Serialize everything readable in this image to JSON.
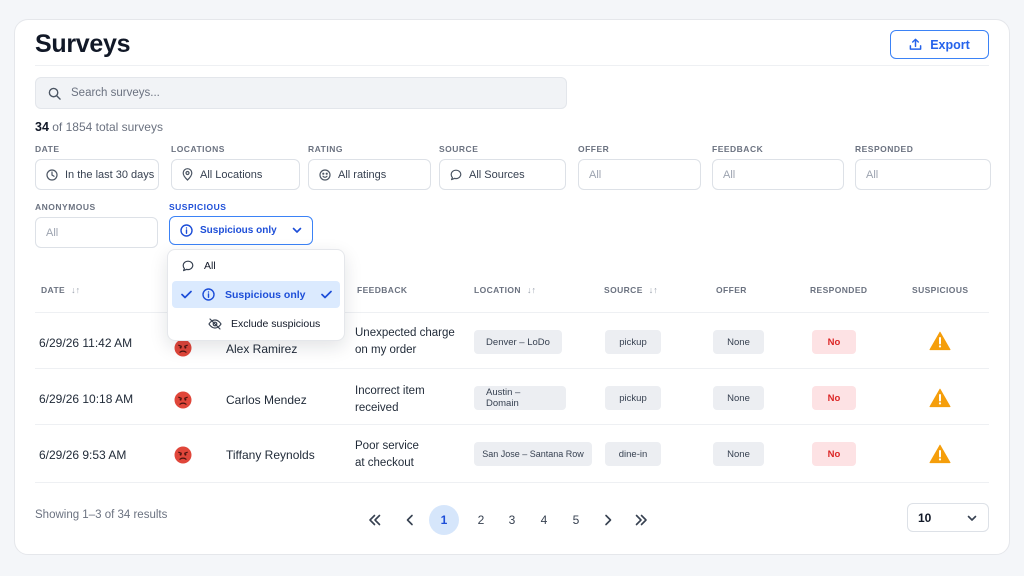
{
  "header": {
    "title": "Surveys",
    "export_label": "Export"
  },
  "search": {
    "placeholder": "Search surveys..."
  },
  "summary": {
    "shown": "34",
    "rest": "of 1854 total surveys"
  },
  "filters": {
    "date": {
      "label": "DATE",
      "value": "In the last 30 days"
    },
    "locations": {
      "label": "LOCATIONS",
      "value": "All Locations"
    },
    "rating": {
      "label": "RATING",
      "value": "All ratings"
    },
    "source": {
      "label": "SOURCE",
      "value": "All Sources"
    },
    "offer": {
      "label": "OFFER",
      "value": "All"
    },
    "feedback": {
      "label": "FEEDBACK",
      "value": "All"
    },
    "responded": {
      "label": "RESPONDED",
      "value": "All"
    },
    "anonymous": {
      "label": "ANONYMOUS",
      "value": "All"
    },
    "suspicious": {
      "label": "SUSPICIOUS",
      "value": "Suspicious only"
    }
  },
  "dropdown": {
    "options": [
      {
        "label": "All",
        "icon": "speech-bubble-icon"
      },
      {
        "label": "Suspicious only",
        "icon": "info-circle-icon",
        "selected": true
      },
      {
        "label": "Exclude suspicious",
        "icon": "eye-off-icon"
      }
    ]
  },
  "table": {
    "columns": [
      "DATE",
      "FEEDBACK",
      "LOCATION",
      "SOURCE",
      "OFFER",
      "RESPONDED",
      "SUSPICIOUS"
    ],
    "rows": [
      {
        "date": "6/29/26 11:42 AM",
        "rating_icon": "angry-face-icon",
        "name": "Alex Ramirez",
        "feedback_1": "Unexpected charge",
        "feedback_2": "on my order",
        "location": "Denver – LoDo",
        "source": "pickup",
        "offer": "None",
        "responded": "No",
        "suspicious_icon": "warning-icon"
      },
      {
        "date": "6/29/26 10:18 AM",
        "rating_icon": "angry-face-icon",
        "name": "Carlos Mendez",
        "feedback_1": "Incorrect item",
        "feedback_2": "received",
        "location": "Austin – Domain",
        "source": "pickup",
        "offer": "None",
        "responded": "No",
        "suspicious_icon": "warning-icon"
      },
      {
        "date": "6/29/26 9:53 AM",
        "rating_icon": "angry-face-icon",
        "name": "Tiffany Reynolds",
        "feedback_1": "Poor service",
        "feedback_2": "at checkout",
        "location": "San Jose – Santana Row",
        "source": "dine-in",
        "offer": "None",
        "responded": "No",
        "suspicious_icon": "warning-icon"
      }
    ]
  },
  "footer": {
    "showing": "Showing 1–3 of 34 results",
    "pages": [
      "1",
      "2",
      "3",
      "4",
      "5"
    ],
    "current_page": "1",
    "per_page": "10"
  },
  "colors": {
    "accent": "#2563eb",
    "danger": "#dc2626",
    "warning": "#f59e0b",
    "angry": "#e0463a"
  }
}
